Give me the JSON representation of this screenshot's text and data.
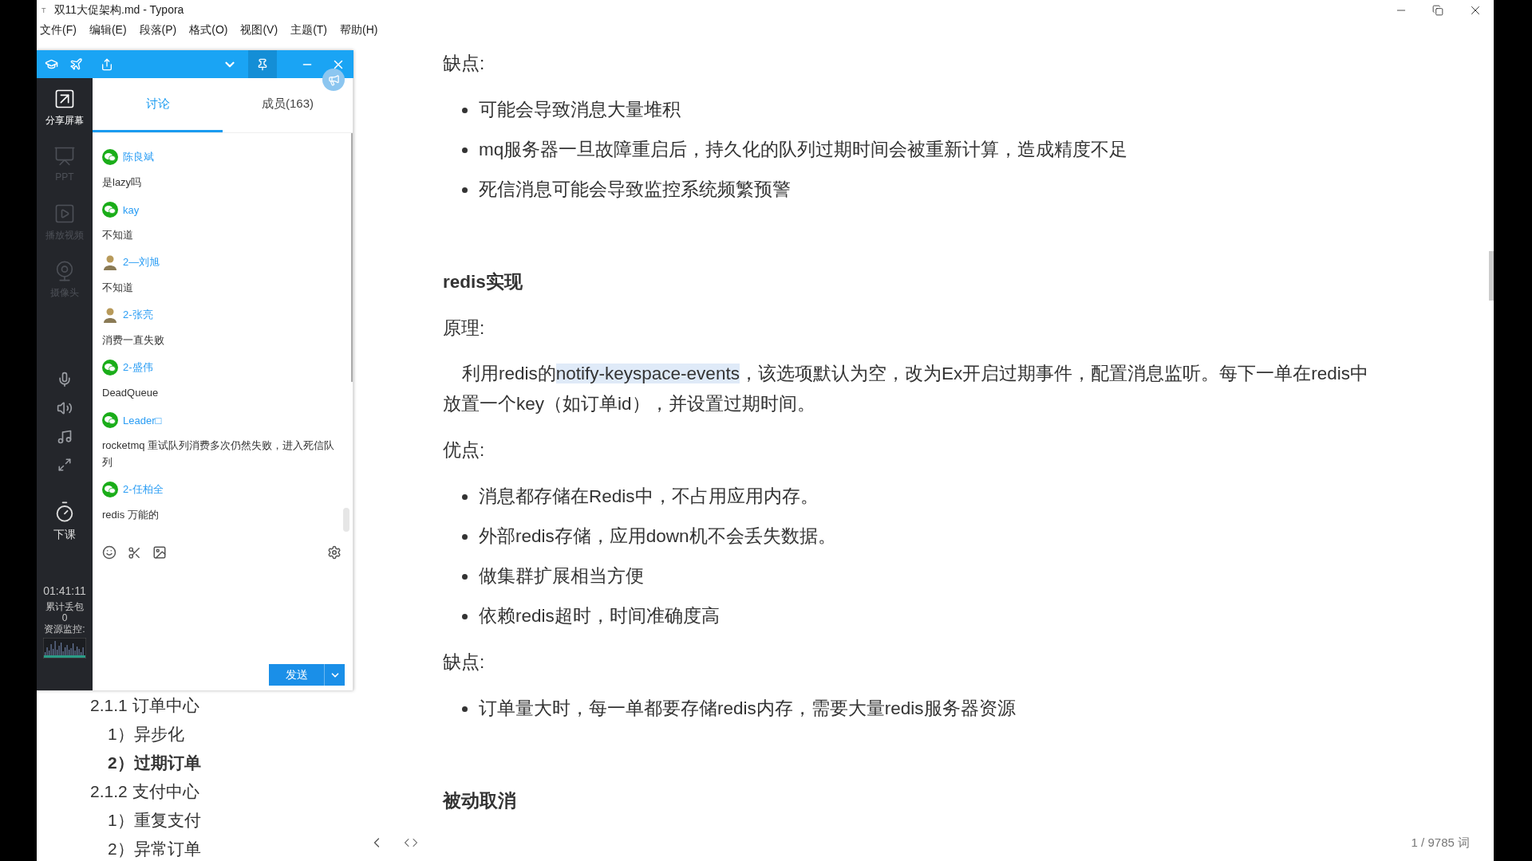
{
  "window": {
    "app_icon": "T",
    "title": "双11大促架构.md - Typora"
  },
  "menu": [
    "文件(F)",
    "编辑(E)",
    "段落(P)",
    "格式(O)",
    "视图(V)",
    "主题(T)",
    "帮助(H)"
  ],
  "outline": [
    {
      "label": "2.1.1 订单中心",
      "selected": false,
      "children": [
        {
          "label": "1）异步化",
          "selected": false
        },
        {
          "label": "2）过期订单",
          "selected": true
        }
      ]
    },
    {
      "label": "2.1.2 支付中心",
      "selected": false,
      "children": [
        {
          "label": "1）重复支付",
          "selected": false
        },
        {
          "label": "2）异常订单",
          "selected": false
        }
      ]
    }
  ],
  "document": {
    "blocks": [
      {
        "kind": "label",
        "text": "缺点:"
      },
      {
        "kind": "list",
        "items": [
          "可能会导致消息大量堆积",
          "mq服务器一旦故障重启后，持久化的队列过期时间会被重新计算，造成精度不足",
          "死信消息可能会导致监控系统频繁预警"
        ]
      },
      {
        "kind": "heading",
        "text": "redis实现"
      },
      {
        "kind": "label",
        "text": "原理:"
      },
      {
        "kind": "paragraph",
        "segments": [
          {
            "text": "利用redis的",
            "highlighted": false
          },
          {
            "text": "notify-keyspace-events",
            "highlighted": true
          },
          {
            "text": "，该选项默认为空，改为Ex开启过期事件，配置消息监听。每下一单在redis中放置一个key（如订单id），并设置过期时间。",
            "highlighted": false
          }
        ]
      },
      {
        "kind": "label",
        "text": "优点:"
      },
      {
        "kind": "list",
        "items": [
          "消息都存储在Redis中，不占用应用内存。",
          "外部redis存储，应用down机不会丢失数据。",
          "做集群扩展相当方便",
          "依赖redis超时，时间准确度高"
        ]
      },
      {
        "kind": "label",
        "text": "缺点:"
      },
      {
        "kind": "list",
        "items": [
          "订单量大时，每一单都要存储redis内存，需要大量redis服务器资源"
        ]
      },
      {
        "kind": "heading",
        "text": "被动取消"
      }
    ]
  },
  "status_bar": {
    "word_count": "1 / 9785 词"
  },
  "classroom_panel": {
    "rail": [
      {
        "label": "分享屏幕",
        "disabled": false
      },
      {
        "label": "PPT",
        "disabled": true
      },
      {
        "label": "播放视频",
        "disabled": true
      },
      {
        "label": "摄像头",
        "disabled": true
      }
    ],
    "end_class": "下课",
    "timer": "01:41:11",
    "packet_loss_label": "累计丢包",
    "packet_loss": "0",
    "monitor_label": "资源监控:",
    "tabs": [
      {
        "label": "讨论",
        "selected": true
      },
      {
        "label": "成员(163)",
        "selected": false
      }
    ],
    "messages": [
      {
        "kind": "wechat",
        "name": "陈良斌",
        "text": "是lazy吗"
      },
      {
        "kind": "wechat",
        "name": "kay",
        "text": "不知道"
      },
      {
        "kind": "photo",
        "name": "2—刘旭",
        "text": "不知道"
      },
      {
        "kind": "photo",
        "name": "2-张亮",
        "text": "消费一直失败"
      },
      {
        "kind": "wechat",
        "name": "2-盛伟",
        "text": "DeadQueue"
      },
      {
        "kind": "wechat",
        "name": "Leader□",
        "text": "rocketmq 重试队列消费多次仍然失败，进入死信队列"
      },
      {
        "kind": "wechat",
        "name": "2-任柏全",
        "text": "redis 万能的"
      }
    ],
    "send": "发送"
  }
}
